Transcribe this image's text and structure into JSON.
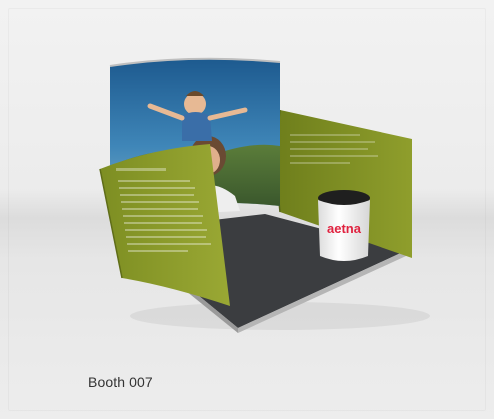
{
  "product": {
    "title": "Booth 007",
    "brand_text": "aetna"
  },
  "colors": {
    "panel_green": "#8a9a2a",
    "floor": "#3b3d40",
    "brand_red": "#e0223f",
    "background": "#ececec",
    "title_text": "#333333"
  }
}
